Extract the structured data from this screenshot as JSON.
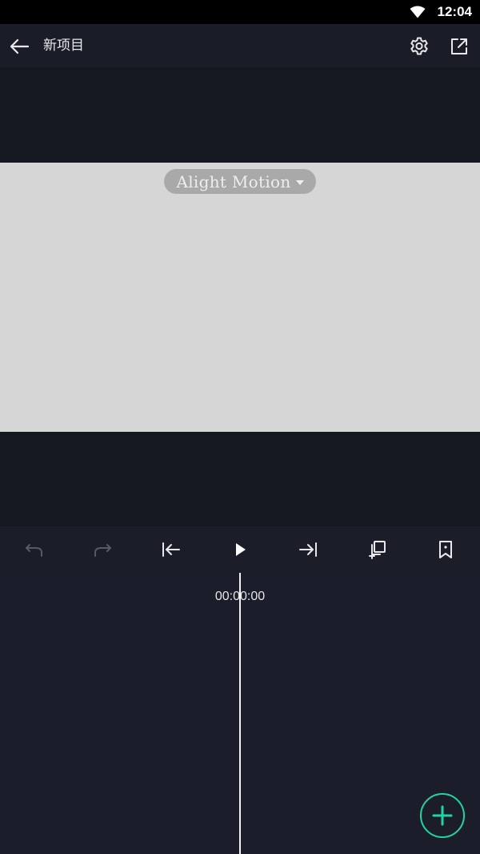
{
  "status_bar": {
    "time": "12:04",
    "wifi_icon": "wifi-icon"
  },
  "app_bar": {
    "title": "新项目",
    "back_icon": "arrow-left-icon",
    "settings_icon": "gear-icon",
    "export_icon": "export-icon"
  },
  "preview": {
    "watermark_label": "Alight Motion",
    "watermark_icon": "caret-down-icon",
    "canvas_color": "#d6d6d6"
  },
  "toolbar": {
    "items": [
      {
        "name": "undo",
        "icon": "undo-icon",
        "enabled": false
      },
      {
        "name": "redo",
        "icon": "redo-icon",
        "enabled": false
      },
      {
        "name": "skip-to-start",
        "icon": "skip-to-start-icon",
        "enabled": true
      },
      {
        "name": "play",
        "icon": "play-icon",
        "enabled": true
      },
      {
        "name": "skip-to-end",
        "icon": "skip-to-end-icon",
        "enabled": true
      },
      {
        "name": "duplicate",
        "icon": "duplicate-icon",
        "enabled": true
      },
      {
        "name": "bookmark",
        "icon": "bookmark-icon",
        "enabled": true
      }
    ]
  },
  "timeline": {
    "timecode": "00:00:00"
  },
  "fab": {
    "icon": "plus-icon",
    "accent_color": "#21d4a0"
  }
}
